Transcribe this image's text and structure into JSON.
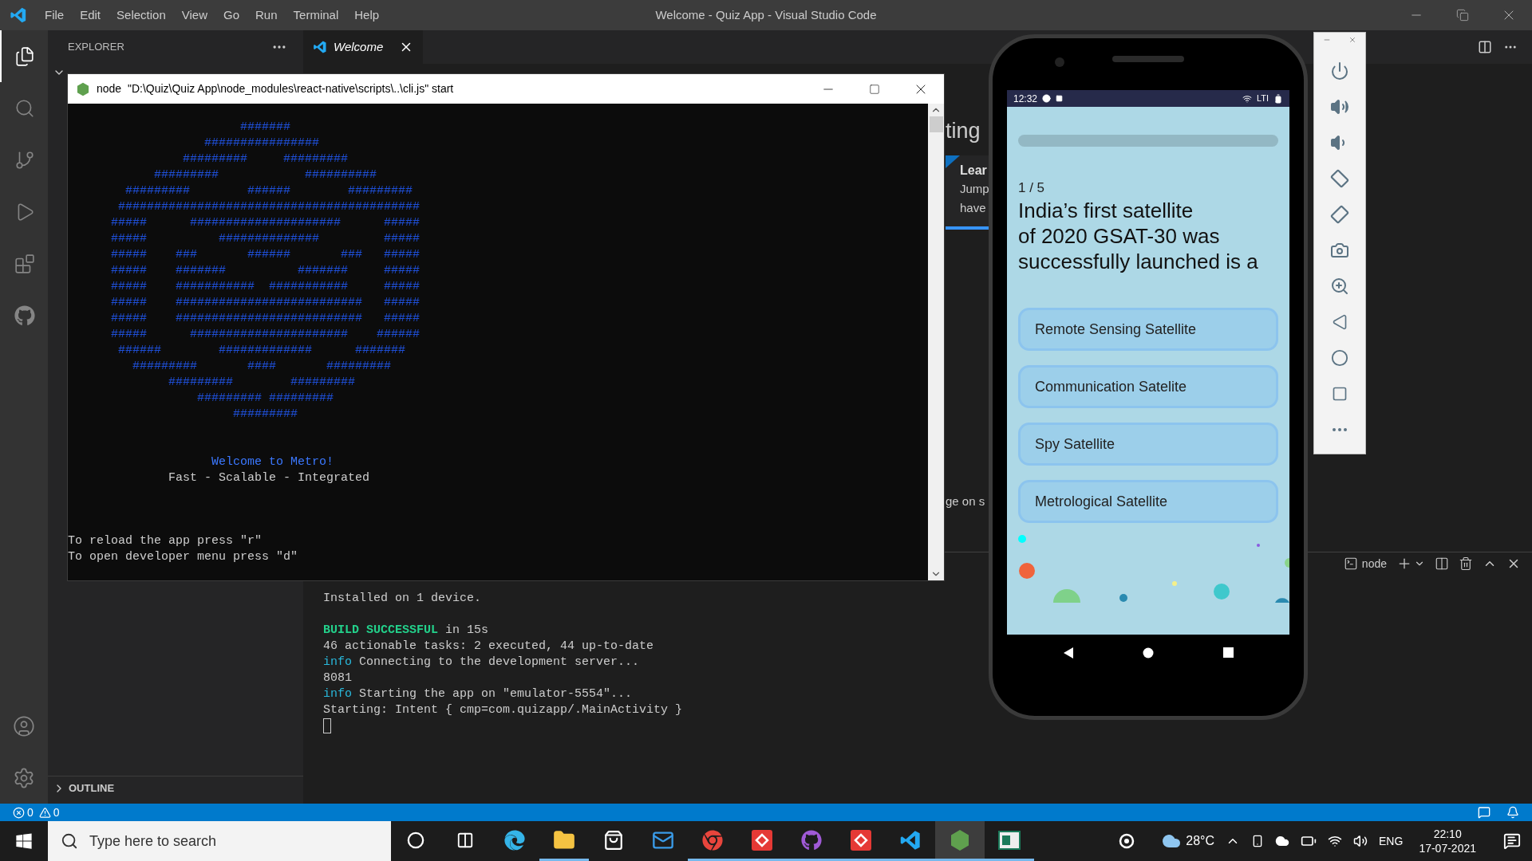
{
  "window": {
    "title": "Welcome - Quiz App - Visual Studio Code"
  },
  "menu": [
    "File",
    "Edit",
    "Selection",
    "View",
    "Go",
    "Run",
    "Terminal",
    "Help"
  ],
  "activity_bar": [
    {
      "kind": "files",
      "selected": true
    },
    {
      "kind": "search",
      "selected": false
    },
    {
      "kind": "source-control",
      "selected": false
    },
    {
      "kind": "run",
      "selected": false
    },
    {
      "kind": "extensions",
      "selected": false
    },
    {
      "kind": "github",
      "selected": false
    }
  ],
  "sidebar": {
    "title": "EXPLORER",
    "outline": {
      "label": "OUTLINE",
      "expanded": false
    }
  },
  "editor_tabs": [
    {
      "label": "Welcome",
      "selected": true
    }
  ],
  "welcome_fragments": {
    "heading": "ting",
    "card_title": "Lear",
    "card_lines": [
      "Jump",
      "have"
    ],
    "footer": "ge on s"
  },
  "console": {
    "title": "node  \"D:\\Quiz\\Quiz App\\node_modules\\react-native\\scripts\\..\\cli.js\" start",
    "ascii_art": [
      "                  #######",
      "             ################",
      "          #########     #########",
      "      #########            ##########",
      "  #########        ######        #########",
      " ##########################################",
      "#####      #####################      #####",
      "#####          ##############         #####",
      "#####    ###       ######       ###   #####",
      "#####    #######          #######     #####",
      "#####    ###########  ###########     #####",
      "#####    ##########################   #####",
      "#####    ##########################   #####",
      "#####      ######################    ######",
      " ######        #############      #######",
      "   #########       ####       #########",
      "        #########        #########",
      "            ######### #########",
      "                 #########"
    ],
    "welcome": "Welcome to Metro!",
    "tagline": "Fast - Scalable - Integrated",
    "hints": [
      "To reload the app press \"r\"",
      "To open developer menu press \"d\""
    ]
  },
  "terminal": {
    "tab": "node",
    "cursor": true,
    "lines": [
      {
        "kind": "plain",
        "text": "Installed on 1 device."
      },
      {
        "kind": "blank"
      },
      {
        "kind": "success",
        "prefix": "BUILD SUCCESSFUL",
        "text": "in 15s"
      },
      {
        "kind": "plain",
        "text": "46 actionable tasks: 2 executed, 44 up-to-date"
      },
      {
        "kind": "info",
        "prefix": "info",
        "text": "Connecting to the development server..."
      },
      {
        "kind": "plain",
        "text": "8081"
      },
      {
        "kind": "info",
        "prefix": "info",
        "text": "Starting the app on \"emulator-5554\"..."
      },
      {
        "kind": "plain",
        "text": "Starting: Intent { cmp=com.quizapp/.MainActivity }"
      }
    ]
  },
  "phone": {
    "time": "12:32",
    "network": "LTI",
    "quiz": {
      "progress": {
        "level": 0
      },
      "counter": "1 / 5",
      "question": "India’s first satellite\nof 2020 GSAT-30 was\nsuccessfully launched is a",
      "options": [
        {
          "label": "Remote Sensing Satellite",
          "selected": false
        },
        {
          "label": "Communication Satelite",
          "selected": false
        },
        {
          "label": "Spy Satellite",
          "selected": false
        },
        {
          "label": "Metrological Satellite",
          "selected": false
        }
      ]
    }
  },
  "status_bar": {
    "errors": "0",
    "warnings": "0"
  },
  "taskbar": {
    "search_placeholder": "Type here to search",
    "apps": [
      {
        "kind": "cortana",
        "running": false,
        "selected": false
      },
      {
        "kind": "task-view",
        "running": false,
        "selected": false
      },
      {
        "kind": "edge",
        "running": false,
        "selected": false
      },
      {
        "kind": "explorer",
        "running": true,
        "selected": false
      },
      {
        "kind": "store",
        "running": false,
        "selected": false
      },
      {
        "kind": "mail",
        "running": false,
        "selected": false
      },
      {
        "kind": "chrome",
        "running": true,
        "selected": false
      },
      {
        "kind": "git-red",
        "running": true,
        "selected": false
      },
      {
        "kind": "github",
        "running": true,
        "selected": false
      },
      {
        "kind": "git-red",
        "running": true,
        "selected": false
      },
      {
        "kind": "vscode",
        "running": true,
        "selected": false
      },
      {
        "kind": "node",
        "running": true,
        "selected": true
      },
      {
        "kind": "window-app",
        "running": true,
        "selected": false
      }
    ],
    "weather": "28°C",
    "language": "ENG",
    "time": "22:10",
    "date": "17-07-2021"
  }
}
